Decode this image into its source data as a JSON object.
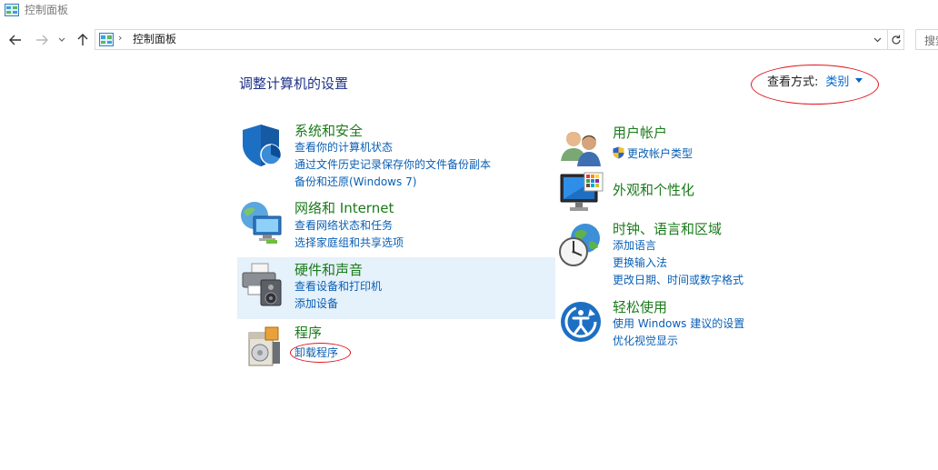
{
  "window": {
    "title": "控制面板"
  },
  "address": {
    "crumb": "控制面板",
    "search_placeholder": "搜索控制面板"
  },
  "main": {
    "heading": "调整计算机的设置",
    "view_by_label": "查看方式:",
    "view_by_value": "类别"
  },
  "categories": {
    "security": {
      "title": "系统和安全",
      "links": [
        "查看你的计算机状态",
        "通过文件历史记录保存你的文件备份副本",
        "备份和还原(Windows 7)"
      ]
    },
    "network": {
      "title": "网络和 Internet",
      "links": [
        "查看网络状态和任务",
        "选择家庭组和共享选项"
      ]
    },
    "hardware": {
      "title": "硬件和声音",
      "links": [
        "查看设备和打印机",
        "添加设备"
      ]
    },
    "programs": {
      "title": "程序",
      "links": [
        "卸载程序"
      ]
    },
    "accounts": {
      "title": "用户帐户",
      "links": [
        "更改帐户类型"
      ]
    },
    "appearance": {
      "title": "外观和个性化",
      "links": []
    },
    "clock": {
      "title": "时钟、语言和区域",
      "links": [
        "添加语言",
        "更换输入法",
        "更改日期、时间或数字格式"
      ]
    },
    "ease": {
      "title": "轻松使用",
      "links": [
        "使用 Windows 建议的设置",
        "优化视觉显示"
      ]
    }
  },
  "icons": {
    "back": "back-arrow-icon",
    "forward": "forward-arrow-icon",
    "recent": "chevron-down-icon",
    "up": "up-arrow-icon",
    "refresh": "refresh-icon"
  },
  "colors": {
    "title_green": "#1b7a1b",
    "link_blue": "#0a5fb4",
    "heading_blue": "#1e3287",
    "highlight": "#e5f1fb",
    "annotation_red": "#e0141a"
  }
}
